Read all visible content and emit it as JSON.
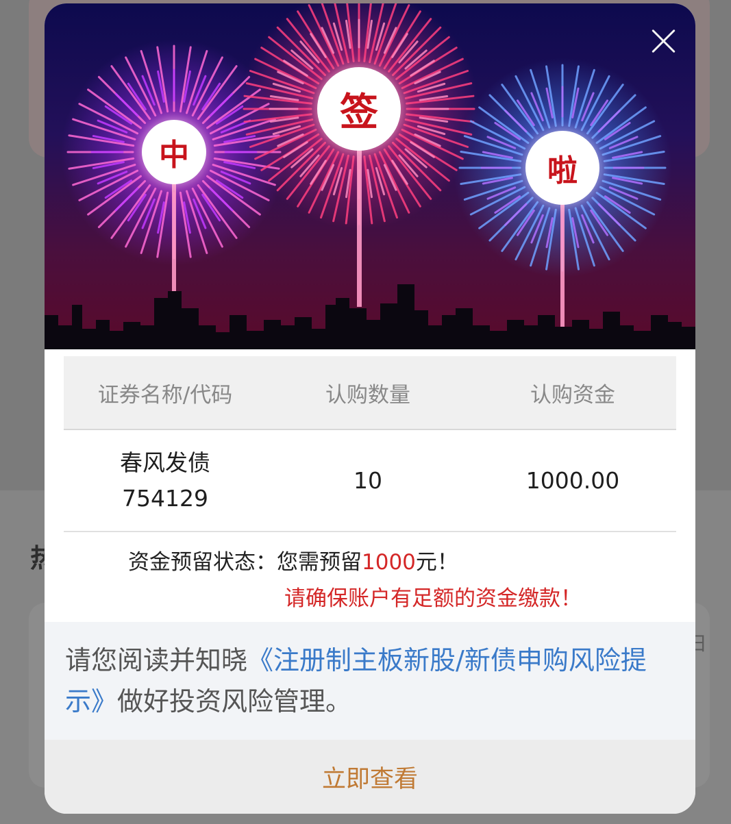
{
  "background": {
    "section_heading": "热",
    "side_text": "日"
  },
  "banner": {
    "badges": [
      "中",
      "签",
      "啦"
    ]
  },
  "table": {
    "headers": [
      "证券名称/代码",
      "认购数量",
      "认购资金"
    ],
    "rows": [
      {
        "name": "春风发债",
        "code": "754129",
        "quantity": "10",
        "amount": "1000.00"
      }
    ]
  },
  "reserve": {
    "label": "资金预留状态：",
    "prefix": "您需预留",
    "amount": "1000",
    "suffix": "元！",
    "warning": "请确保账户有足额的资金缴款！"
  },
  "notice": {
    "before": "请您阅读并知晓",
    "link": "《注册制主板新股/新债申购风险提示》",
    "after": "做好投资风险管理。"
  },
  "actions": {
    "view_label": "立即查看"
  },
  "colors": {
    "accent_red": "#d42727",
    "link_blue": "#3a7ac9",
    "button_text": "#c07a34"
  }
}
